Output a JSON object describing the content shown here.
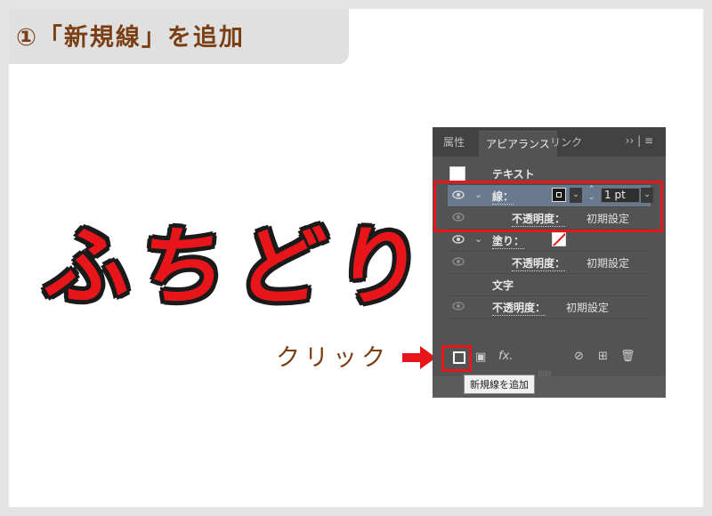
{
  "step_title": "①「新規線」を追加",
  "sample_text": "ふちどり",
  "callout": {
    "label": "クリック",
    "color": "#7a3f14",
    "arrow_color": "#e8151b"
  },
  "panel": {
    "tabs": [
      {
        "label": "属性",
        "active": false
      },
      {
        "label": "アピアランス",
        "active": true
      },
      {
        "label": "リンク",
        "active": false
      }
    ],
    "tab_menu": "›› | ≡",
    "rows": {
      "text_header": {
        "label": "テキスト"
      },
      "stroke": {
        "label": "線：",
        "weight": "1 pt",
        "color": "#1a1a1a"
      },
      "stroke_opacity": {
        "label": "不透明度：",
        "value": "初期設定"
      },
      "fill": {
        "label": "塗り：",
        "color": "#ffffff"
      },
      "fill_opacity": {
        "label": "不透明度：",
        "value": "初期設定"
      },
      "characters": {
        "label": "文字"
      },
      "opacity": {
        "label": "不透明度：",
        "value": "初期設定"
      }
    },
    "bottom_icons": {
      "new_stroke": "add-new-stroke",
      "new_fill": "add-new-fill",
      "fx": "fx",
      "clear": "clear-appearance",
      "duplicate": "duplicate-item",
      "delete": "delete-item"
    },
    "fx_label": "fx.",
    "tooltip": "新規線を追加"
  },
  "colors": {
    "accent_red": "#e8151b",
    "brown": "#7a3f14",
    "panel_bg": "#535353"
  }
}
